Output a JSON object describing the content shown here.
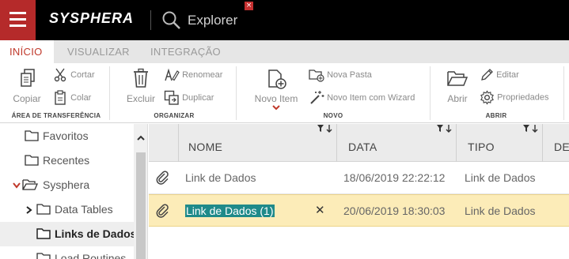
{
  "app": {
    "brand": "SYSPHERA",
    "title": "Explorer",
    "close_glyph": "×"
  },
  "icons": {
    "menu": "hamburger-icon",
    "search": "search-icon"
  },
  "colors": {
    "brand_red": "#b52a2a",
    "topbar": "#000000",
    "active_tab": "#c0392b",
    "selected_row": "#fcecb8",
    "edit_highlight": "#1f8a8a"
  },
  "ribbon_tabs": [
    "INÍCIO",
    "VISUALIZAR",
    "INTEGRAÇÃO"
  ],
  "ribbon": {
    "clipboard": {
      "label": "ÁREA DE TRANSFERÊNCIA",
      "copy": "Copiar",
      "cut": "Cortar",
      "paste": "Colar"
    },
    "organize": {
      "label": "ORGANIZAR",
      "delete": "Excluir",
      "rename": "Renomear",
      "duplicate": "Duplicar"
    },
    "new": {
      "label": "NOVO",
      "new_item": "Novo Item",
      "new_folder": "Nova Pasta",
      "new_item_wizard": "Novo Item com Wizard"
    },
    "open": {
      "label": "ABRIR",
      "open": "Abrir",
      "edit": "Editar",
      "properties": "Propriedades"
    }
  },
  "tree": [
    {
      "label": "Favoritos"
    },
    {
      "label": "Recentes"
    },
    {
      "label": "Sysphera"
    },
    {
      "label": "Data Tables"
    },
    {
      "label": "Links de Dados"
    },
    {
      "label": "Load Routines"
    }
  ],
  "grid": {
    "columns": [
      "NOME",
      "DATA",
      "TIPO",
      "DE"
    ],
    "rows": [
      {
        "name": "Link de Dados",
        "date": "18/06/2019 22:22:12",
        "type": "Link de Dados"
      },
      {
        "name": "Link de Dados (1)",
        "date": "20/06/2019 18:30:03",
        "type": "Link de Dados",
        "cancel": "✕"
      }
    ]
  }
}
